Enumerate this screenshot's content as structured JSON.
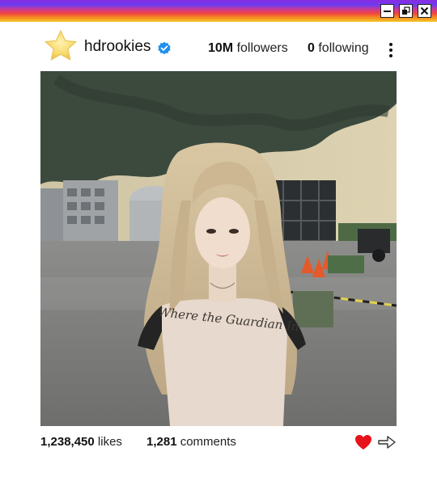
{
  "window": {
    "minimize_icon": "minimize-icon",
    "restore_icon": "restore-icon",
    "close_icon": "close-icon"
  },
  "profile": {
    "avatar_icon": "star-icon",
    "username": "hdrookies",
    "verified_icon": "verified-badge-icon",
    "followers_count": "10M",
    "followers_label": "followers",
    "following_count": "0",
    "following_label": "following",
    "more_icon": "more-vertical-icon"
  },
  "post": {
    "likes_count": "1,238,450",
    "likes_label": "likes",
    "comments_count": "1,281",
    "comments_label": "comments",
    "shirt_text": "Where the Guardian In",
    "like_icon": "heart-icon",
    "share_icon": "share-arrow-icon",
    "like_color": "#e8121b"
  }
}
